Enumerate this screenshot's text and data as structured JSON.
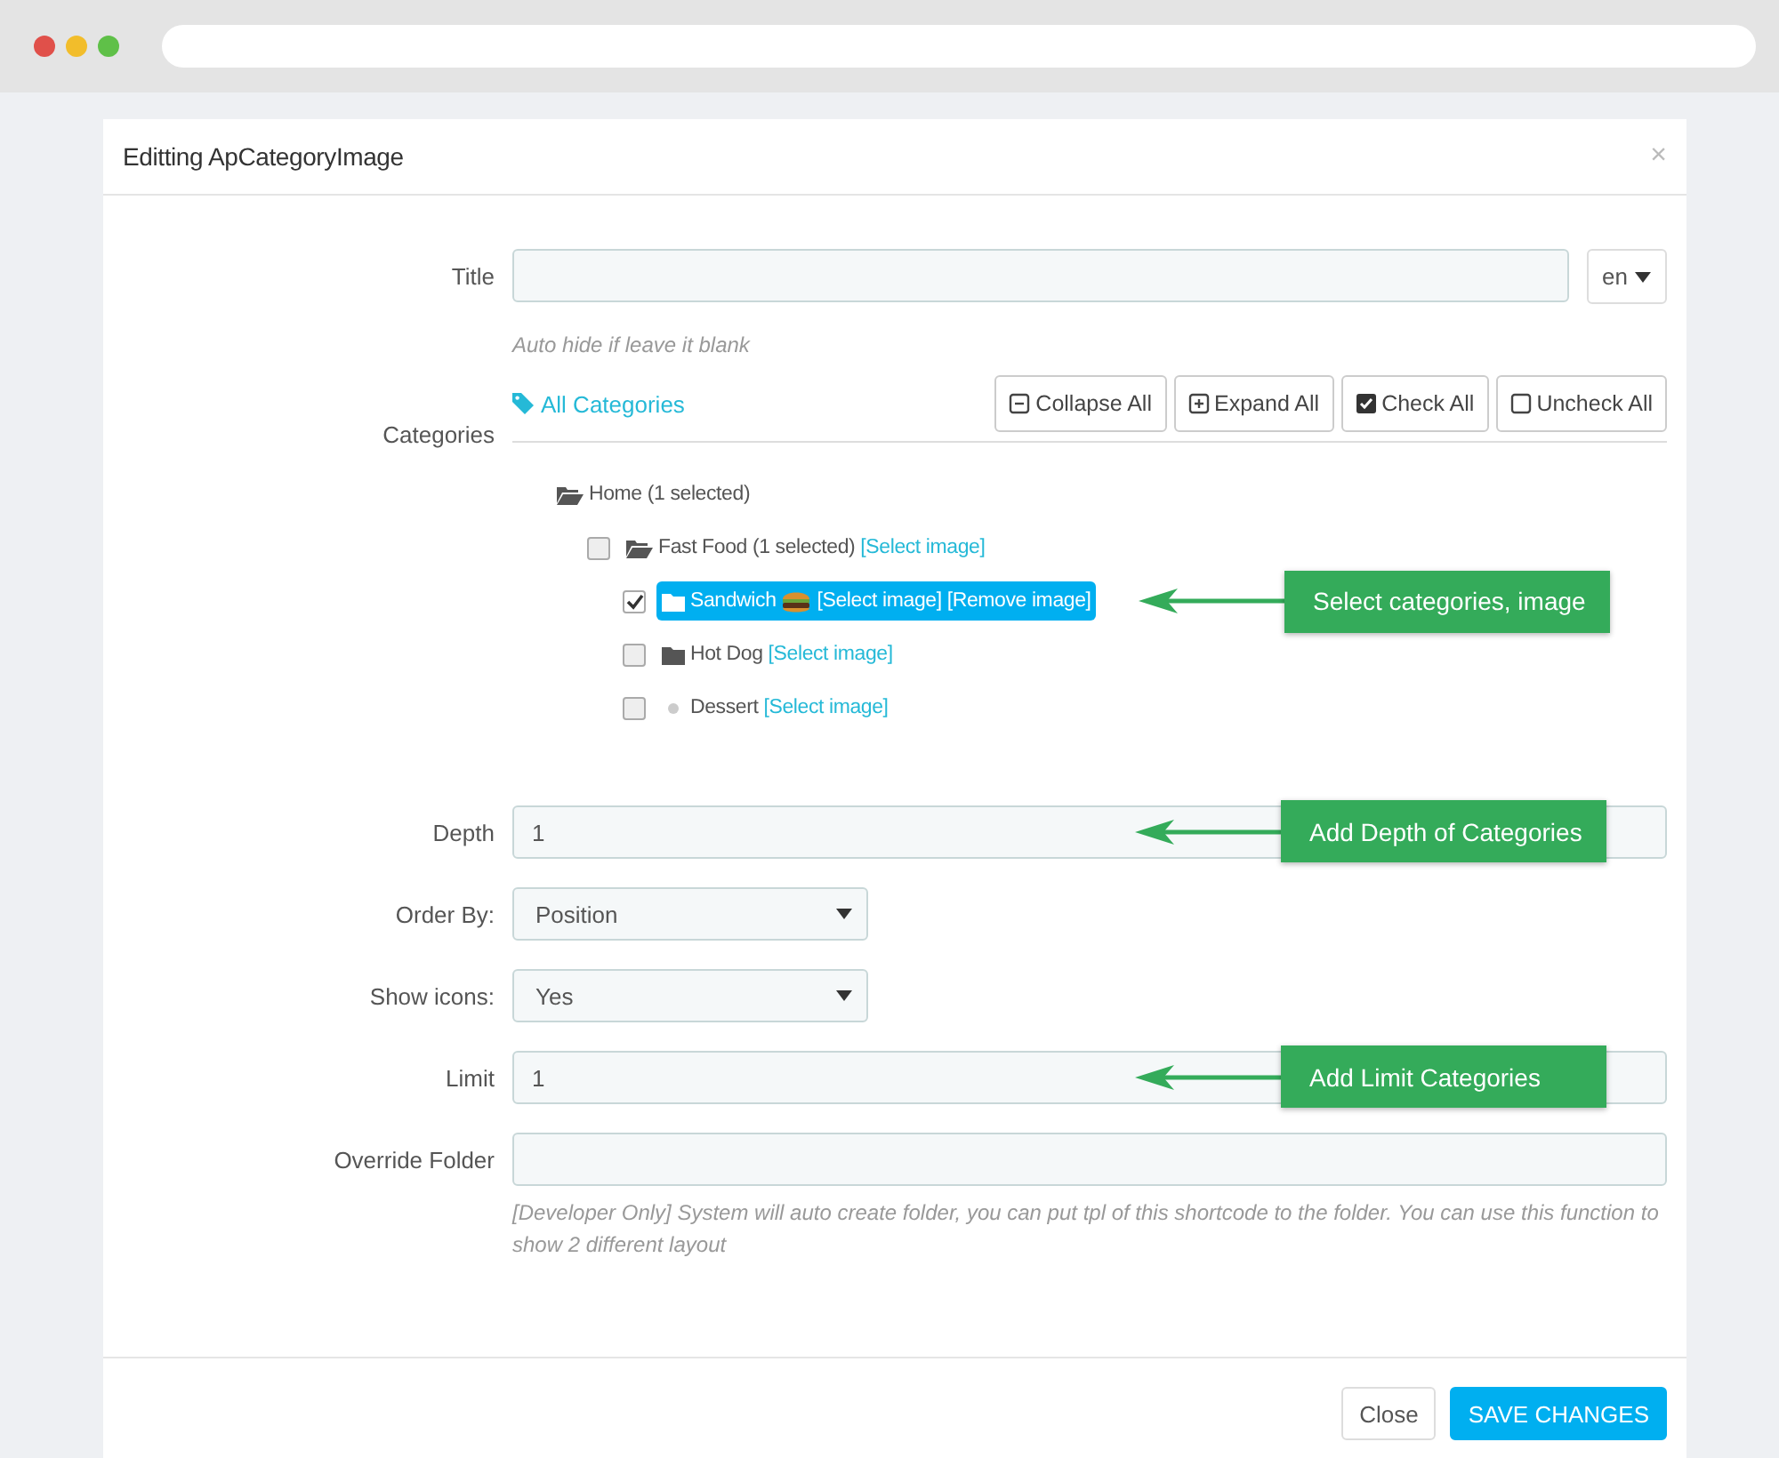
{
  "modal": {
    "title": "Editting ApCategoryImage",
    "close": "×"
  },
  "title_field": {
    "label": "Title",
    "language": "en",
    "help": "Auto hide if leave it blank"
  },
  "categories": {
    "label": "Categories",
    "all_link": "All Categories",
    "buttons": [
      {
        "label": "Collapse All",
        "kind": "collapse"
      },
      {
        "label": "Expand All",
        "kind": "expand"
      },
      {
        "label": "Check All",
        "kind": "check"
      },
      {
        "label": "Uncheck All",
        "kind": "uncheck"
      }
    ],
    "tree": [
      {
        "kind": "root",
        "label": "Home",
        "count": "(1 selected)",
        "expanded": true,
        "children": [
          {
            "kind": "folder",
            "label": "Fast Food",
            "count": "(1 selected)",
            "checked": false,
            "expanded": true,
            "links": [
              "[Select image]"
            ],
            "children": [
              {
                "kind": "folder",
                "label": "Sandwich",
                "checked": true,
                "expanded": false,
                "thumbnail": true,
                "links": [
                  "[Select image]",
                  "[Remove image]"
                ],
                "annotation": "Select categories, image"
              },
              {
                "kind": "folder",
                "label": "Hot Dog",
                "checked": false,
                "expanded": false,
                "links": [
                  "[Select image]"
                ]
              },
              {
                "kind": "leaf",
                "label": "Dessert",
                "checked": false,
                "links": [
                  "[Select image]"
                ]
              }
            ]
          }
        ]
      }
    ]
  },
  "fields": [
    {
      "label": "Depth",
      "kind": "text",
      "value": "1",
      "annotation": "Add Depth of Categories"
    },
    {
      "label": "Order By:",
      "kind": "select",
      "value": "Position"
    },
    {
      "label": "Show icons:",
      "kind": "select",
      "value": "Yes"
    },
    {
      "label": "Limit",
      "kind": "text",
      "value": "1",
      "annotation": "Add Limit Categories"
    },
    {
      "label": "Override Folder",
      "kind": "text",
      "help": "[Developer Only] System will auto create folder, you can put tpl of this shortcode to the folder. You can use this function to show 2 different layout"
    }
  ],
  "footer": {
    "buttons": [
      {
        "label": "Close",
        "kind": "default"
      },
      {
        "label": "SAVE CHANGES",
        "kind": "primary"
      }
    ]
  }
}
